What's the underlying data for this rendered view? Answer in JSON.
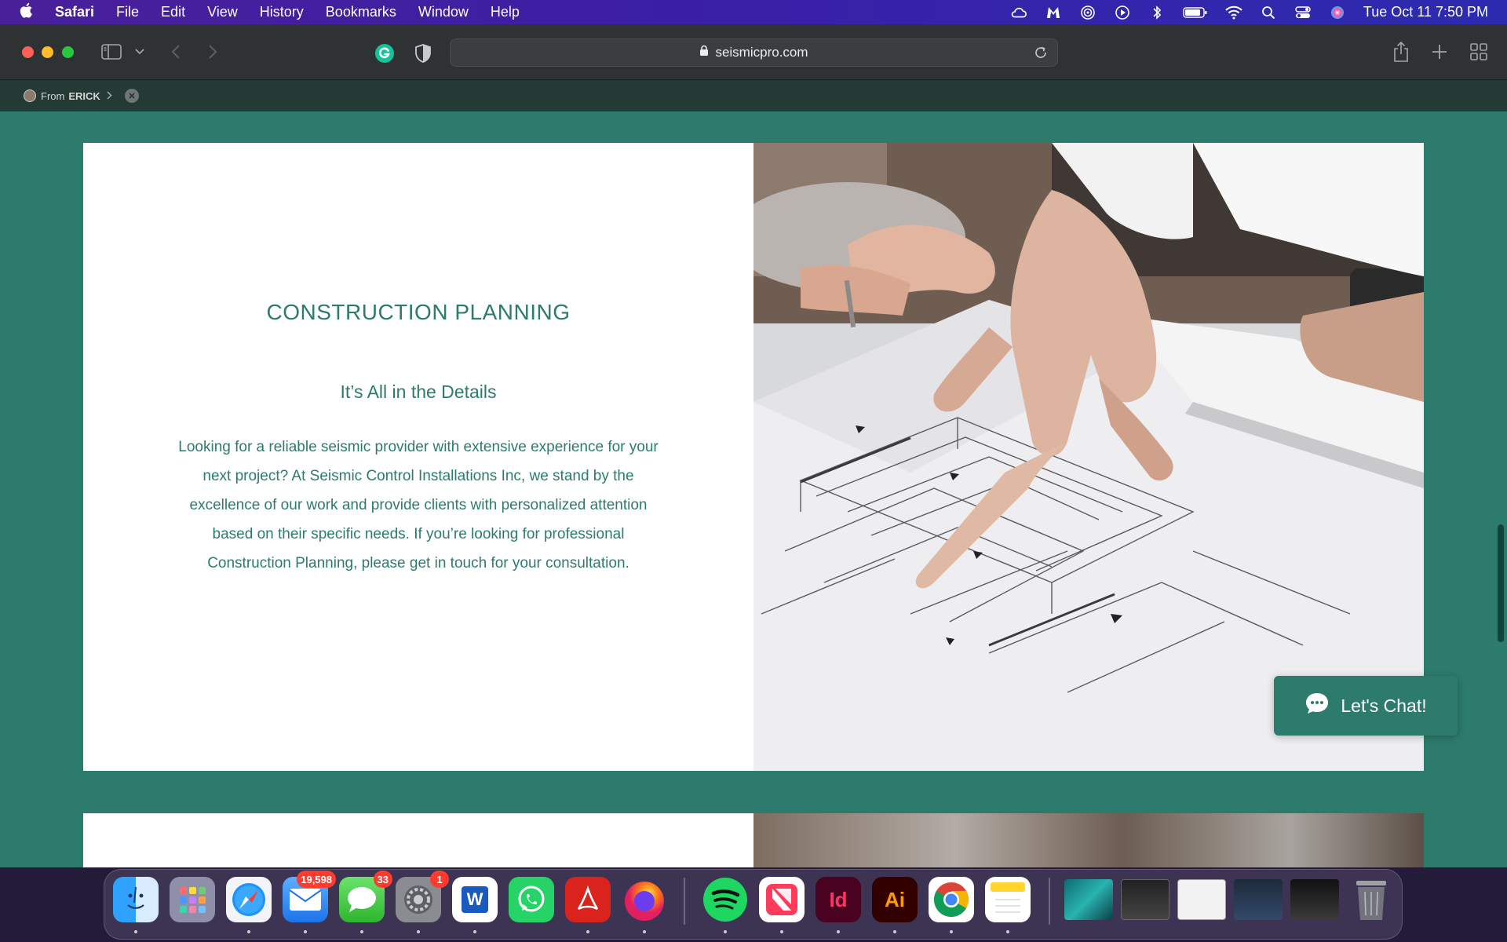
{
  "menubar": {
    "app_name": "Safari",
    "menus": [
      "File",
      "Edit",
      "View",
      "History",
      "Bookmarks",
      "Window",
      "Help"
    ],
    "clock": "Tue Oct 11  7:50 PM"
  },
  "browser": {
    "url": "seismicpro.com",
    "favorites_bar": {
      "from_label": "From",
      "from_name": "ERICK"
    }
  },
  "section": {
    "title": "CONSTRUCTION PLANNING",
    "subtitle": "It’s All in the Details",
    "body": "Looking for a reliable seismic provider with extensive experience for your next project? At Seismic Control Installations Inc, we stand by the excellence of our work and provide clients with personalized attention based on their specific needs. If you’re looking for professional Construction Planning, please get in touch for your consultation."
  },
  "chat": {
    "label": "Let's Chat!"
  },
  "dock": {
    "badges": {
      "mail": "19,598",
      "messages": "33",
      "settings": "1"
    },
    "indesign_label": "Id",
    "illustrator_label": "Ai",
    "word_label": "W"
  },
  "colors": {
    "brand_teal": "#2c7b6d",
    "menubar_purple": "#3a1fa6"
  }
}
